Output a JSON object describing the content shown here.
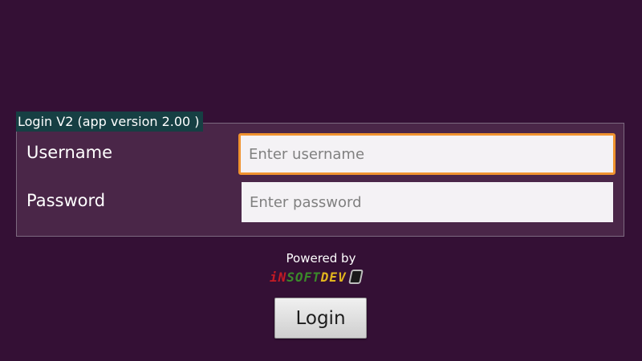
{
  "login_panel": {
    "title": "Login V2 (app version 2.00 )",
    "username": {
      "label": "Username",
      "placeholder": "Enter username",
      "value": ""
    },
    "password": {
      "label": "Password",
      "placeholder": "Enter password",
      "value": ""
    }
  },
  "footer": {
    "powered_by": "Powered by",
    "brand": {
      "part_a": "iN",
      "part_b": "SOFT",
      "part_c": "DEV",
      "mark_icon": "brand-device-icon"
    }
  },
  "login_button_label": "Login",
  "colors": {
    "background": "#341035",
    "panel": "#4a2648",
    "title_bar": "#163f43",
    "focus_border": "#f0932f"
  }
}
